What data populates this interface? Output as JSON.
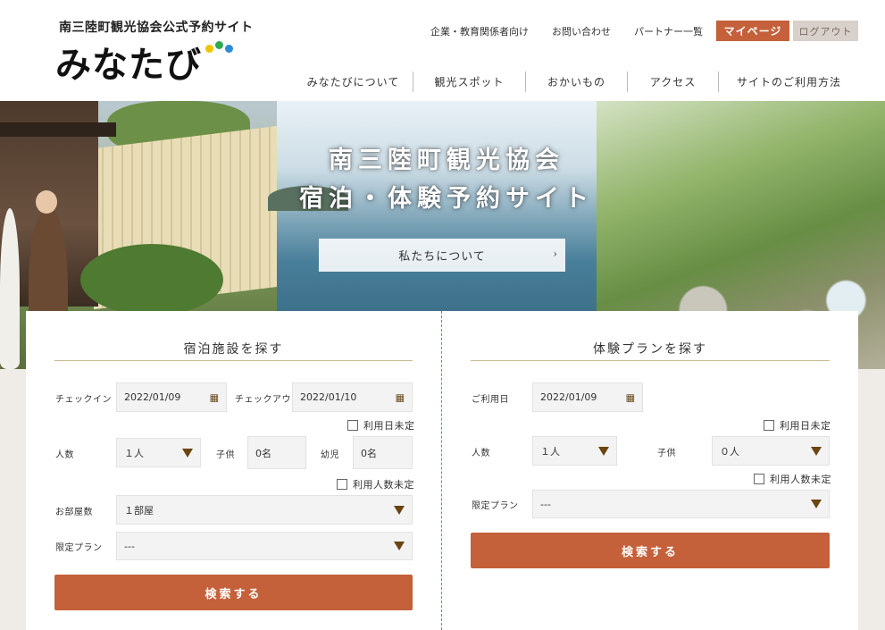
{
  "header": {
    "logo_sub": "南三陸町観光協会公式予約サイト",
    "logo_main": "みなたび",
    "logo_dot_colors": [
      "#f2c400",
      "#2fa84f",
      "#2d8bd6"
    ],
    "top_links": [
      "企業・教育関係者向け",
      "お問い合わせ",
      "パートナー一覧"
    ],
    "mypage_label": "マイページ",
    "logout_label": "ログアウト",
    "nav": [
      "みなたびについて",
      "観光スポット",
      "おかいもの",
      "アクセス",
      "サイトのご利用方法"
    ]
  },
  "hero": {
    "title_line1": "南三陸町観光協会",
    "title_line2": "宿泊・体験予約サイト",
    "button_label": "私たちについて",
    "button_chevron": "›"
  },
  "stay": {
    "title": "宿泊施設を探す",
    "checkin_label": "チェックイン",
    "checkin_value": "2022/01/09",
    "checkout_label": "チェックアウト",
    "checkout_value": "2022/01/10",
    "date_undecided": "利用日未定",
    "people_label": "人数",
    "people_value": "１人",
    "child_label": "子供",
    "child_value": "0名",
    "infant_label": "幼児",
    "infant_value": "0名",
    "people_undecided": "利用人数未定",
    "rooms_label": "お部屋数",
    "rooms_value": "１部屋",
    "plan_label": "限定プラン",
    "plan_value": "---",
    "search_label": "検索する"
  },
  "experience": {
    "title": "体験プランを探す",
    "date_label": "ご利用日",
    "date_value": "2022/01/09",
    "date_undecided": "利用日未定",
    "people_label": "人数",
    "people_value": "１人",
    "child_label": "子供",
    "child_value": "０人",
    "people_undecided": "利用人数未定",
    "plan_label": "限定プラン",
    "plan_value": "---",
    "search_label": "検索する"
  },
  "colors": {
    "accent": "#c4603a",
    "logout_bg": "#d8d0ca",
    "divider": "#b8793c",
    "title_line": "#c9bc8f",
    "arrow": "#6b4410"
  }
}
